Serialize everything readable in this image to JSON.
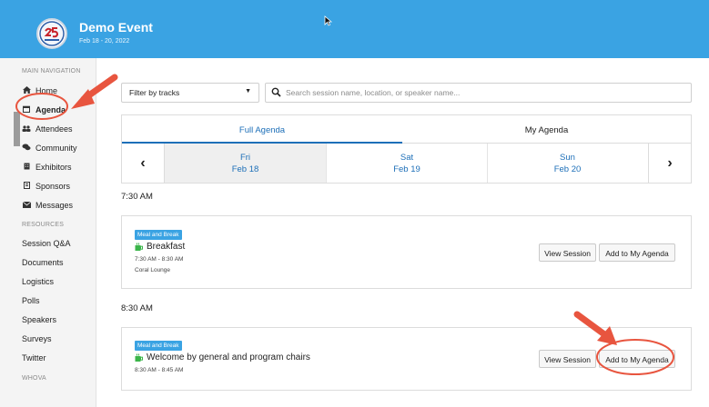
{
  "header": {
    "event_title": "Demo Event",
    "event_dates": "Feb 18 - 20, 2022",
    "logo_icon": "anniversary-25-logo",
    "bg_color": "#3aa3e3"
  },
  "sidebar": {
    "main_heading": "MAIN NAVIGATION",
    "items": [
      {
        "label": "Home",
        "icon": "home-icon"
      },
      {
        "label": "Agenda",
        "icon": "calendar-icon"
      },
      {
        "label": "Attendees",
        "icon": "people-icon"
      },
      {
        "label": "Community",
        "icon": "chat-icon"
      },
      {
        "label": "Exhibitors",
        "icon": "building-icon"
      },
      {
        "label": "Sponsors",
        "icon": "sponsor-icon"
      },
      {
        "label": "Messages",
        "icon": "envelope-icon"
      }
    ],
    "resources_heading": "RESOURCES",
    "resources": [
      "Session Q&A",
      "Documents",
      "Logistics",
      "Polls",
      "Speakers",
      "Surveys",
      "Twitter"
    ],
    "footer_heading": "WHOVA"
  },
  "filter": {
    "tracks_label": "Filter by tracks",
    "search_placeholder": "Search session name, location, or speaker name..."
  },
  "tabs": {
    "full": "Full Agenda",
    "my": "My Agenda"
  },
  "days": [
    {
      "dow": "Fri",
      "date": "Feb 18"
    },
    {
      "dow": "Sat",
      "date": "Feb 19"
    },
    {
      "dow": "Sun",
      "date": "Feb 20"
    }
  ],
  "nav": {
    "prev": "‹",
    "next": "›"
  },
  "sections": [
    {
      "time": "7:30 AM",
      "session": {
        "badge": "Meal and Break",
        "title": "Breakfast",
        "time_range": "7:30 AM - 8:30 AM",
        "location": "Coral Lounge",
        "view_label": "View Session",
        "add_label": "Add to My Agenda"
      }
    },
    {
      "time": "8:30 AM",
      "session": {
        "badge": "Meal and Break",
        "title": "Welcome by general and program chairs",
        "time_range": "8:30 AM - 8:45 AM",
        "view_label": "View Session",
        "add_label": "Add to My Agenda"
      }
    }
  ],
  "colors": {
    "accent": "#1d6fb8",
    "badge": "#3aa3e3",
    "annotation": "#e8553f",
    "coffee_icon": "#3bb54a"
  }
}
